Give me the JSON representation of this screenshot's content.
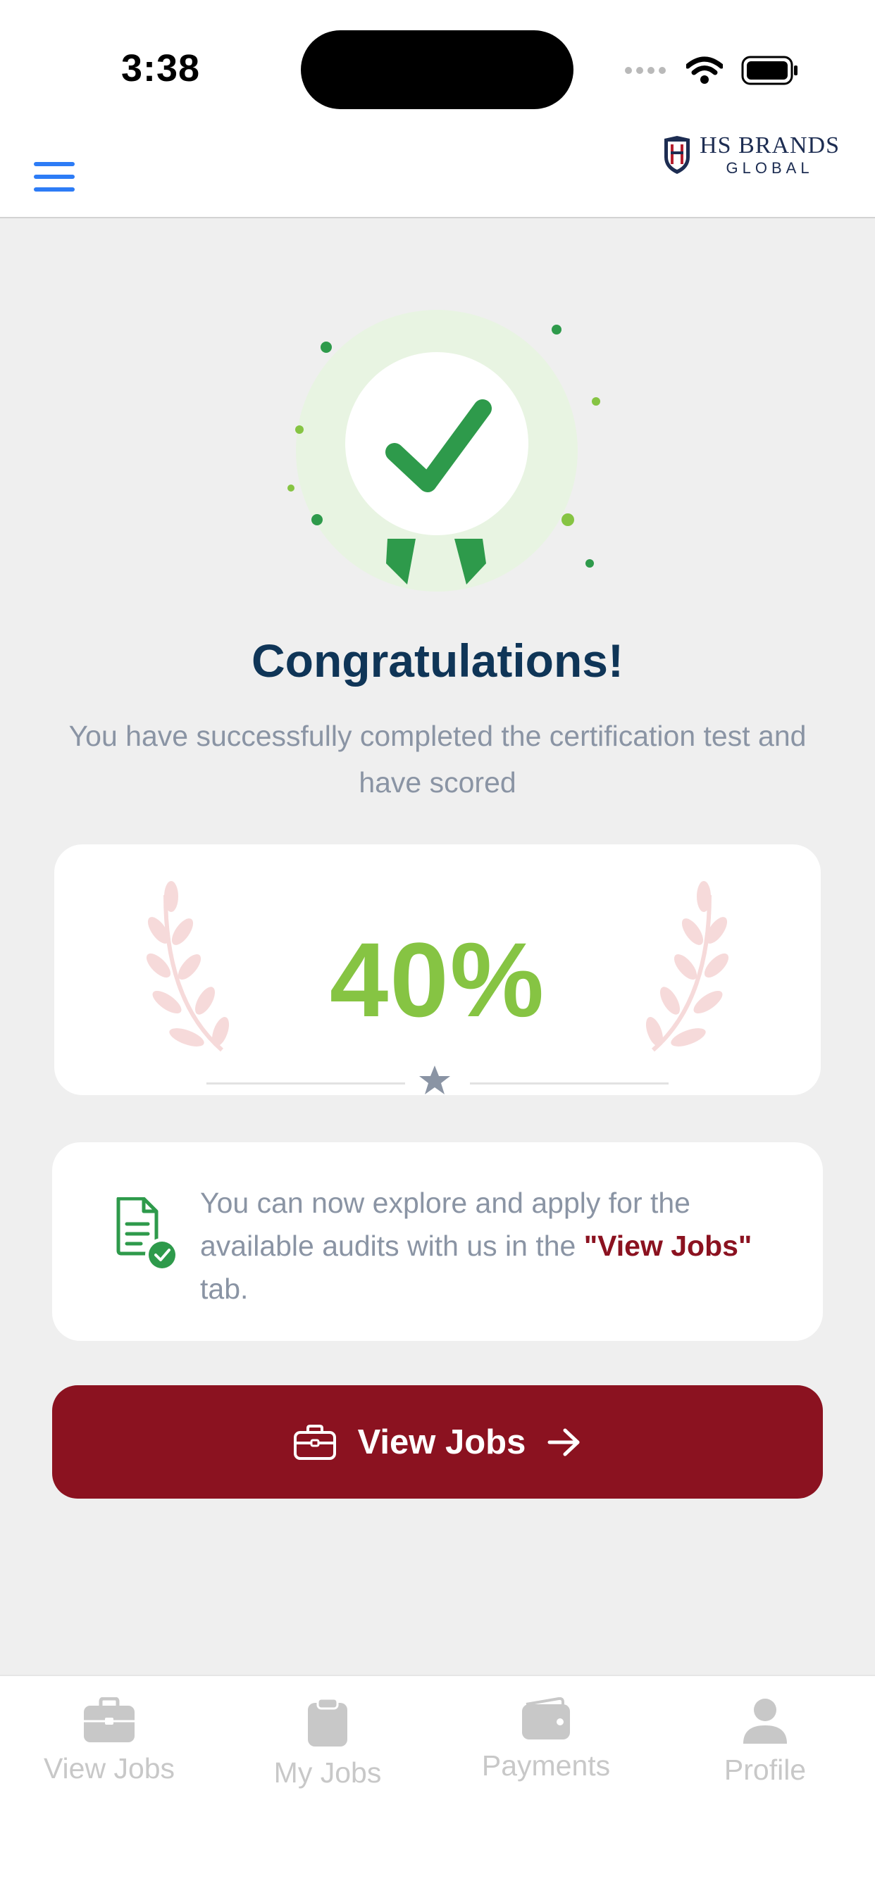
{
  "status_bar": {
    "time": "3:38"
  },
  "header": {
    "logo_brand": "HS BRANDS",
    "logo_sub": "GLOBAL"
  },
  "main": {
    "title": "Congratulations!",
    "subtitle": "You have successfully completed the certification test and have scored",
    "score": "40%",
    "info": {
      "text_before": "You can now explore and apply for the available audits with us in the ",
      "highlight": "\"View Jobs\"",
      "text_after": " tab."
    },
    "cta_label": "View Jobs"
  },
  "tabbar": {
    "items": [
      {
        "label": "View Jobs",
        "icon": "briefcase-icon"
      },
      {
        "label": "My Jobs",
        "icon": "clipboard-icon"
      },
      {
        "label": "Payments",
        "icon": "wallet-icon"
      },
      {
        "label": "Profile",
        "icon": "person-icon"
      }
    ]
  },
  "colors": {
    "accent_primary": "#8b1220",
    "score_green": "#86c443",
    "title_navy": "#0f3557",
    "menu_blue": "#2d7cf6"
  }
}
